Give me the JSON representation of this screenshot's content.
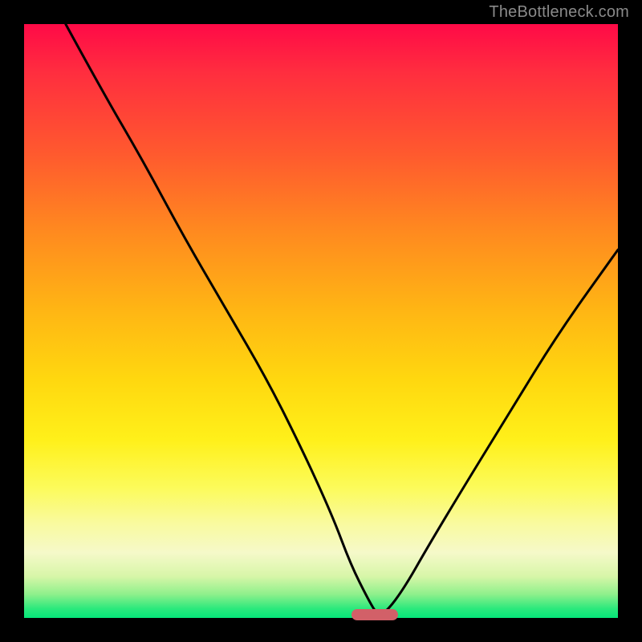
{
  "watermark": "TheBottleneck.com",
  "colors": {
    "curve": "#000000",
    "marker": "#d26068",
    "gradient_top": "#ff0a47",
    "gradient_bottom": "#05e679"
  },
  "chart_data": {
    "type": "line",
    "title": "",
    "xlabel": "",
    "ylabel": "",
    "xlim": [
      0,
      100
    ],
    "ylim": [
      0,
      100
    ],
    "note": "Axis values are unlabeled in the original; x and y are normalized 0–100 from pixel positions. y=100 is top (high bottleneck), y=0 is bottom.",
    "series": [
      {
        "name": "bottleneck-curve",
        "x": [
          7,
          13,
          20,
          27,
          34,
          41,
          47,
          52,
          55,
          58,
          59.5,
          61,
          64,
          68,
          74,
          82,
          90,
          100
        ],
        "values": [
          100,
          89,
          77,
          64,
          52,
          40,
          28,
          17,
          9,
          3,
          0.5,
          1,
          5,
          12,
          22,
          35,
          48,
          62
        ]
      }
    ],
    "marker": {
      "name": "optimal-point",
      "x": 59,
      "y": 0.5
    }
  }
}
